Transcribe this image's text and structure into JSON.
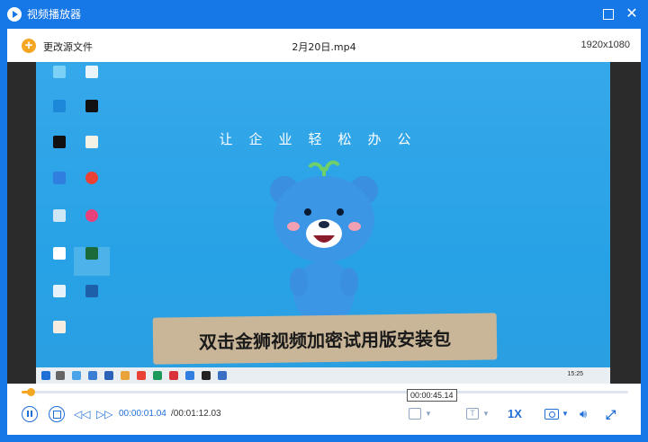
{
  "window": {
    "title": "视频播放器"
  },
  "topbar": {
    "change_source": "更改源文件",
    "file_name": "2月20日.mp4",
    "resolution": "1920x1080"
  },
  "video": {
    "slogan": "让企业轻松办公",
    "banner": "双击金狮视频加密试用版安装包",
    "taskbar_time": "15:25"
  },
  "playback": {
    "progress": 0.015,
    "current_time": "00:00:01.04",
    "total_time": "/00:01:12.03",
    "hover_time": "00:00:45.14",
    "speed": "1X",
    "text_button": "T"
  },
  "colors": {
    "window_blue": "#1677e6",
    "accent_orange": "#f5a623",
    "control_blue": "#1f6fd6"
  }
}
